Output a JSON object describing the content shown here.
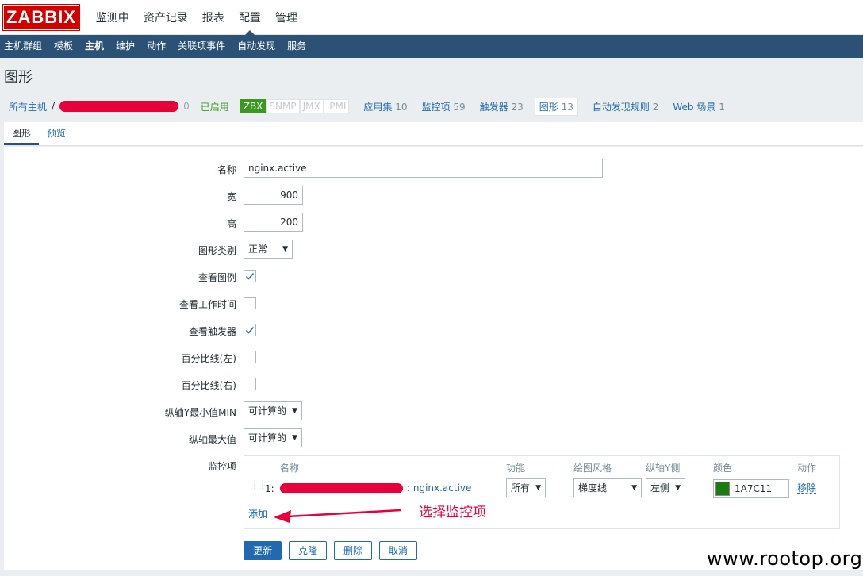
{
  "brand": "ZABBIX",
  "top_menu": [
    "监测中",
    "资产记录",
    "报表",
    "配置",
    "管理"
  ],
  "top_menu_active": "配置",
  "sub_menu": [
    "主机群组",
    "模板",
    "主机",
    "维护",
    "动作",
    "关联项事件",
    "自动发现",
    "服务"
  ],
  "sub_menu_active": "主机",
  "page_title": "图形",
  "breadcrumb": {
    "all_hosts": "所有主机",
    "sep": "/",
    "host_tail": "0",
    "status": "已启用",
    "badges": [
      "ZBX",
      "SNMP",
      "JMX",
      "IPMI"
    ],
    "items": [
      {
        "label": "应用集",
        "count": "10"
      },
      {
        "label": "监控项",
        "count": "59"
      },
      {
        "label": "触发器",
        "count": "23"
      },
      {
        "label": "图形",
        "count": "13"
      },
      {
        "label": "自动发现规则",
        "count": "2"
      },
      {
        "label": "Web 场景",
        "count": "1"
      }
    ]
  },
  "tabs": [
    "图形",
    "预览"
  ],
  "form": {
    "name_label": "名称",
    "name_value": "nginx.active",
    "width_label": "宽",
    "width_value": "900",
    "height_label": "高",
    "height_value": "200",
    "type_label": "图形类别",
    "type_value": "正常",
    "legend_label": "查看图例",
    "worktime_label": "查看工作时间",
    "triggers_label": "查看触发器",
    "pct_left_label": "百分比线(左)",
    "pct_right_label": "百分比线(右)",
    "ymin_label": "纵轴Y最小值MIN",
    "ymin_value": "可计算的",
    "ymax_label": "纵轴最大值",
    "ymax_value": "可计算的",
    "items_label": "监控项"
  },
  "items_table": {
    "headers": [
      "名称",
      "功能",
      "绘图风格",
      "纵轴Y侧",
      "颜色",
      "动作"
    ],
    "row": {
      "index": "1:",
      "name": ": nginx.active",
      "function": "所有",
      "style": "梯度线",
      "yside": "左侧",
      "color_hex": "1A7C11",
      "action": "移除"
    },
    "add": "添加"
  },
  "annotation": "选择监控项",
  "buttons": [
    "更新",
    "克隆",
    "删除",
    "取消"
  ],
  "watermark": "www.rootop.org",
  "colors": {
    "nav": "#2b5274",
    "accent": "#1f6ab0",
    "brand": "#d40000",
    "swatch": "#1a7c11"
  }
}
